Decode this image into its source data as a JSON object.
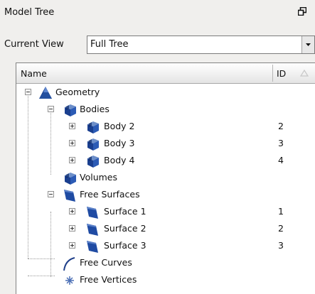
{
  "panel": {
    "title": "Model Tree"
  },
  "current_view": {
    "label": "Current View",
    "value": "Full Tree"
  },
  "columns": {
    "name": "Name",
    "id": "ID"
  },
  "tree": [
    {
      "label": "Geometry",
      "id": "",
      "icon": "geometry-icon",
      "expander": "minus"
    },
    {
      "label": "Bodies",
      "id": "",
      "icon": "bodies-icon",
      "expander": "minus"
    },
    {
      "label": "Body 2",
      "id": "2",
      "icon": "body-icon",
      "expander": "plus"
    },
    {
      "label": "Body 3",
      "id": "3",
      "icon": "body-icon",
      "expander": "plus"
    },
    {
      "label": "Body 4",
      "id": "4",
      "icon": "body-icon",
      "expander": "plus"
    },
    {
      "label": "Volumes",
      "id": "",
      "icon": "volumes-icon",
      "expander": "none"
    },
    {
      "label": "Free Surfaces",
      "id": "",
      "icon": "surfaces-icon",
      "expander": "minus"
    },
    {
      "label": "Surface 1",
      "id": "1",
      "icon": "surface-icon",
      "expander": "plus"
    },
    {
      "label": "Surface 2",
      "id": "2",
      "icon": "surface-icon",
      "expander": "plus"
    },
    {
      "label": "Surface 3",
      "id": "3",
      "icon": "surface-icon",
      "expander": "plus"
    },
    {
      "label": "Free Curves",
      "id": "",
      "icon": "curve-icon",
      "expander": "none"
    },
    {
      "label": "Free Vertices",
      "id": "",
      "icon": "vertex-icon",
      "expander": "none"
    }
  ]
}
